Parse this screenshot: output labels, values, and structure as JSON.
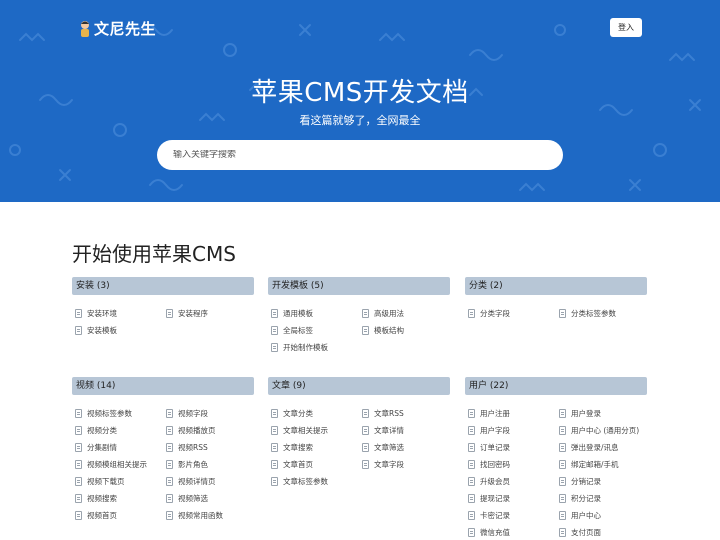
{
  "header": {
    "logo_text": "文尼先生",
    "login_label": "登入"
  },
  "hero": {
    "title": "苹果CMS开发文档",
    "subtitle": "看这篇就够了，全网最全",
    "search_placeholder": "输入关键字搜索"
  },
  "main": {
    "section_title": "开始使用苹果CMS"
  },
  "categories": [
    {
      "title": "安装 (3)",
      "items": [
        "安装环境",
        "安装程序",
        "安装模板"
      ]
    },
    {
      "title": "开发模板 (5)",
      "items": [
        "通用模板",
        "高级用法",
        "全局标签",
        "模板结构",
        "开始制作模板"
      ]
    },
    {
      "title": "分类 (2)",
      "items": [
        "分类字段",
        "分类标签参数"
      ]
    },
    {
      "title": "视频 (14)",
      "items": [
        "视频标签参数",
        "视频字段",
        "视频分类",
        "视频播放页",
        "分集剧情",
        "视频RSS",
        "视频模组相关提示",
        "影片角色",
        "视频下载页",
        "视频详情页",
        "视频搜索",
        "视频筛选",
        "视频首页",
        "视频常用函数"
      ]
    },
    {
      "title": "文章 (9)",
      "items": [
        "文章分类",
        "文章RSS",
        "文章相关提示",
        "文章详情",
        "文章搜索",
        "文章筛选",
        "文章首页",
        "文章字段",
        "文章标签参数"
      ]
    },
    {
      "title": "用户 (22)",
      "items": [
        "用户注册",
        "用户登录",
        "用户字段",
        "用户中心 (通用分页)",
        "订单记录",
        "弹出登录/讯息",
        "找回密码",
        "绑定邮箱/手机",
        "升级会员",
        "分销记录",
        "提现记录",
        "积分记录",
        "卡密记录",
        "用户中心",
        "微信充值",
        "支付页面"
      ]
    }
  ],
  "colors": {
    "hero_bg": "#1e69c5",
    "category_header_bg": "#b7c6d6"
  }
}
